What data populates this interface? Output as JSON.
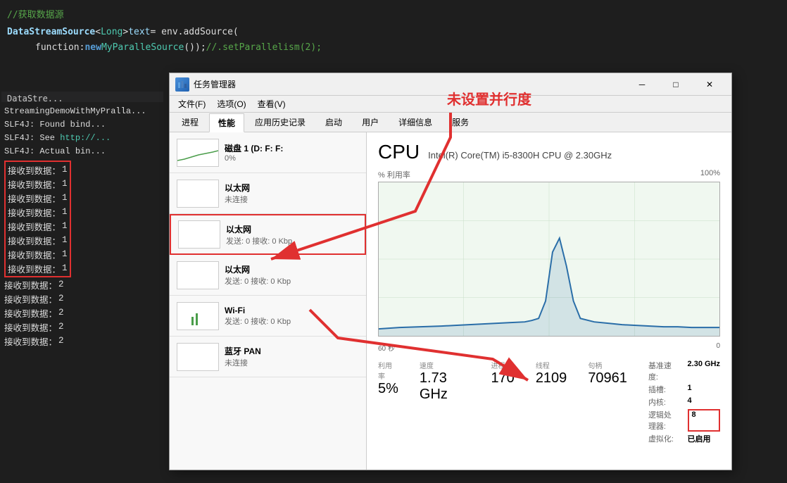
{
  "editor": {
    "bg_color": "#1e1e1e",
    "lines": [
      {
        "text": "//获取数据源",
        "type": "comment"
      },
      {
        "text": "DataStreamSource<Long> text = env.addSource(",
        "type": "normal"
      },
      {
        "text": "    function: new MyParalleSource());//.setParallelism(2);",
        "type": "normal"
      }
    ],
    "sidebar_label": "DataStre..."
  },
  "console": {
    "lines": [
      {
        "text": "StreamingDemoWithMyPrala...",
        "type": "normal"
      },
      {
        "text": "SLF4J: Found bind...",
        "type": "normal"
      },
      {
        "text": "SLF4J: See http://...",
        "type": "link"
      },
      {
        "text": "SLF4J: Actual bin...",
        "type": "normal"
      }
    ],
    "received_data": [
      {
        "label": "接收到数据：",
        "value": "1"
      },
      {
        "label": "接收到数据：",
        "value": "1"
      },
      {
        "label": "接收到数据：",
        "value": "1"
      },
      {
        "label": "接收到数据：",
        "value": "1"
      },
      {
        "label": "接收到数据：",
        "value": "1"
      },
      {
        "label": "接收到数据：",
        "value": "1"
      },
      {
        "label": "接收到数据：",
        "value": "1"
      },
      {
        "label": "接收到数据：",
        "value": "1"
      },
      {
        "label": "接收到数据：",
        "value": "2"
      },
      {
        "label": "接收到数据：",
        "value": "2"
      },
      {
        "label": "接收到数据：",
        "value": "2"
      },
      {
        "label": "接收到数据：",
        "value": "2"
      },
      {
        "label": "接收到数据：",
        "value": "2"
      }
    ]
  },
  "task_manager": {
    "title": "任务管理器",
    "menus": [
      "文件(F)",
      "选项(O)",
      "查看(V)"
    ],
    "tabs": [
      "进程",
      "性能",
      "应用历史记录",
      "启动",
      "用户",
      "详细信息",
      "服务"
    ],
    "active_tab": "性能",
    "devices": [
      {
        "name": "磁盘 1 (D: F: F:",
        "sub": "0%",
        "type": "disk"
      },
      {
        "name": "以太网",
        "sub": "未连接",
        "type": "eth",
        "highlighted": false
      },
      {
        "name": "以太网",
        "sub": "发送: 0  接收: 0 Kbp",
        "type": "eth",
        "highlighted": true
      },
      {
        "name": "以太网",
        "sub": "发送: 0  接收: 0 Kbp",
        "type": "eth",
        "highlighted": false
      },
      {
        "name": "Wi-Fi",
        "sub": "发送: 0  接收: 0 Kbp",
        "type": "wifi"
      },
      {
        "name": "蓝牙 PAN",
        "sub": "未连接",
        "type": "bt"
      }
    ],
    "cpu": {
      "title": "CPU",
      "model": "Intel(R) Core(TM) i5-8300H CPU @ 2.30GHz",
      "utilization_label": "% 利用率",
      "max_label": "100%",
      "time_label_left": "60 秒",
      "time_label_right": "0",
      "utilization_value": "5%",
      "speed_value": "1.73 GHz",
      "process_label": "进程",
      "process_value": "170",
      "thread_label": "线程",
      "thread_value": "2109",
      "handle_label": "句柄",
      "handle_value": "70961",
      "base_speed_label": "基准速度:",
      "base_speed_value": "2.30 GHz",
      "socket_label": "插槽:",
      "socket_value": "1",
      "core_label": "内核:",
      "core_value": "4",
      "logical_label": "逻辑处理器:",
      "logical_value": "8",
      "virtual_label": "虚拟化:",
      "virtual_value": "已启用"
    }
  },
  "annotation": {
    "text": "未设置并行度"
  },
  "icons": {
    "minimize": "─",
    "maximize": "□",
    "close": "✕",
    "task_manager_icon": "📊"
  }
}
